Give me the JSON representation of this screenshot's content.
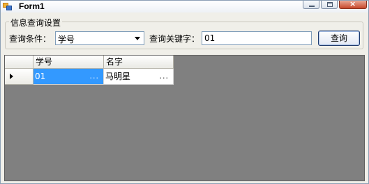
{
  "window": {
    "title": "Form1",
    "controls": {
      "minimize": "minimize-icon",
      "maximize": "maximize-icon",
      "close": "×"
    }
  },
  "group": {
    "title": "信息查询设置",
    "condition_label": "查询条件：",
    "condition_value": "学号",
    "keyword_label": "查询关键字：",
    "keyword_value": "01",
    "search_button": "查询"
  },
  "grid": {
    "columns": [
      "学号",
      "名字"
    ],
    "rows": [
      {
        "cells": [
          "01",
          "马明星"
        ],
        "selected_cell": 0,
        "ellipsis": "..."
      }
    ]
  },
  "colors": {
    "grid_background": "#808080",
    "selection": "#3399ff",
    "window_background": "#f0efe9"
  }
}
